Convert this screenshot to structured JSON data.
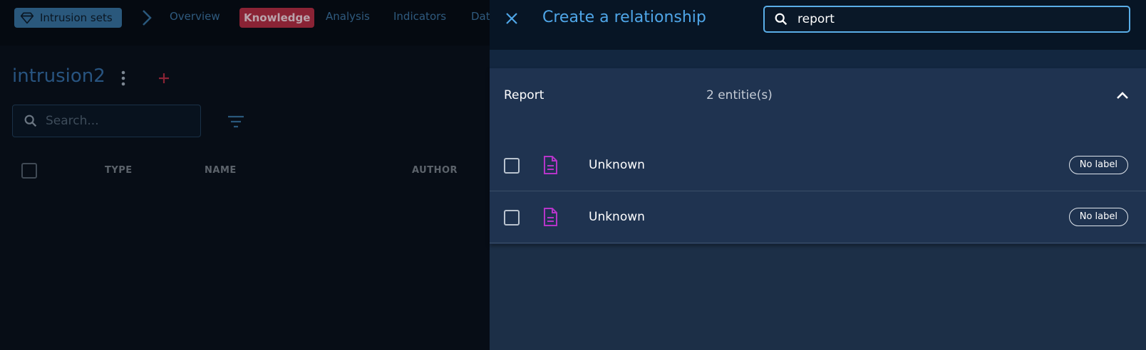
{
  "background": {
    "breadcrumb": {
      "section": "Intrusion sets",
      "icon": "diamond-icon"
    },
    "tabs": [
      {
        "label": "Overview",
        "active": false
      },
      {
        "label": "Knowledge",
        "active": true
      },
      {
        "label": "Analysis",
        "active": false
      },
      {
        "label": "Indicators",
        "active": false
      },
      {
        "label": "Dat",
        "active": false
      }
    ],
    "entity_title": "intrusion2",
    "search": {
      "placeholder": "Search...",
      "value": ""
    },
    "columns": [
      "TYPE",
      "NAME",
      "AUTHOR"
    ]
  },
  "drawer": {
    "title": "Create a relationship",
    "search": {
      "value": "report",
      "placeholder": ""
    },
    "group": {
      "name": "Report",
      "count": "2 entitie(s)",
      "expanded": true
    },
    "items": [
      {
        "name": "Unknown",
        "label_chip": "No label",
        "icon": "document-icon",
        "checked": false
      },
      {
        "name": "Unknown",
        "label_chip": "No label",
        "icon": "document-icon",
        "checked": false
      }
    ]
  },
  "colors": {
    "accent": "#4fa6e8",
    "report_icon": "#b535c8",
    "active_tab": "#8a2335",
    "drawer_bg": "#1c2f47"
  }
}
